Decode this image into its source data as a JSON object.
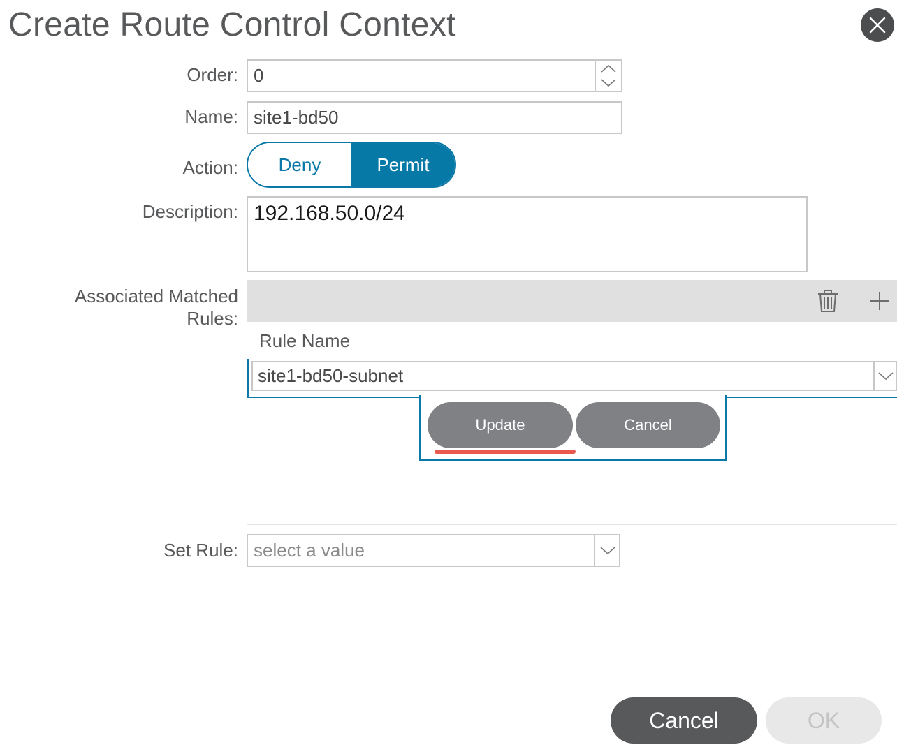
{
  "dialog": {
    "title": "Create Route Control Context"
  },
  "form": {
    "order": {
      "label": "Order:",
      "value": "0"
    },
    "name": {
      "label": "Name:",
      "value": "site1-bd50"
    },
    "action": {
      "label": "Action:",
      "options": [
        "Deny",
        "Permit"
      ],
      "selected": "Permit"
    },
    "description": {
      "label": "Description:",
      "value": "192.168.50.0/24"
    },
    "matched_rules": {
      "label_line1": "Associated Matched",
      "label_line2": "Rules:",
      "column_header": "Rule Name",
      "editing_row_value": "site1-bd50-subnet",
      "update_label": "Update",
      "cancel_label": "Cancel"
    },
    "set_rule": {
      "label": "Set Rule:",
      "placeholder": "select a value"
    }
  },
  "footer": {
    "cancel_label": "Cancel",
    "ok_label": "OK"
  },
  "colors": {
    "accent": "#0679a7",
    "highlight_underline": "#e8584c",
    "pill_gray": "#7f8185"
  }
}
